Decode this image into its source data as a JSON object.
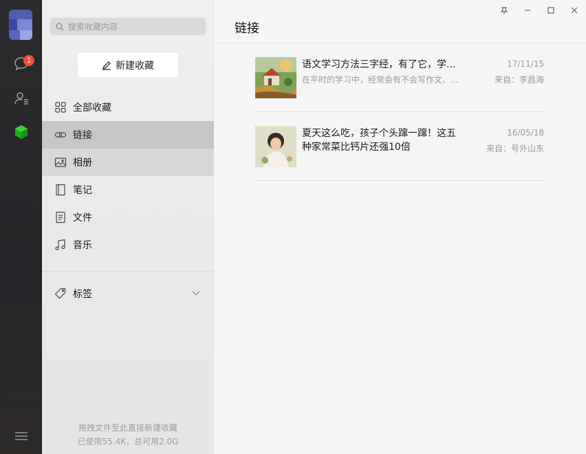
{
  "rail": {
    "badge_count": "1",
    "icons": [
      "avatar",
      "chat-icon",
      "contacts-icon",
      "favorites-cube-icon",
      "menu-icon"
    ],
    "accent": "#1aad19",
    "badge_color": "#f74c31"
  },
  "nav": {
    "search_placeholder": "搜索收藏内容",
    "new_button": "新建收藏",
    "items": [
      {
        "label": "全部收藏",
        "icon": "grid-icon"
      },
      {
        "label": "链接",
        "icon": "link-icon"
      },
      {
        "label": "相册",
        "icon": "image-icon"
      },
      {
        "label": "笔记",
        "icon": "notebook-icon"
      },
      {
        "label": "文件",
        "icon": "file-icon"
      },
      {
        "label": "音乐",
        "icon": "music-icon"
      }
    ],
    "tags_label": "标签",
    "storage_line1": "拖拽文件至此直接新建收藏",
    "storage_line2": "已使用55.4K，总可用2.0G"
  },
  "main": {
    "title": "链接",
    "items": [
      {
        "title": "语文学习方法三字经，有了它，学...",
        "desc": "在平时的学习中，经常会有不会写作文、...",
        "date": "17/11/15",
        "source": "来自：李昌海"
      },
      {
        "title": "夏天这么吃，孩子个头蹿一蹿！这五种家常菜比钙片还强10倍",
        "desc": "",
        "date": "16/05/18",
        "source": "来自：号外山东"
      }
    ]
  },
  "window": {
    "pin": "pin-icon",
    "minimize": "minimize-icon",
    "maximize": "maximize-icon",
    "close": "close-icon"
  }
}
